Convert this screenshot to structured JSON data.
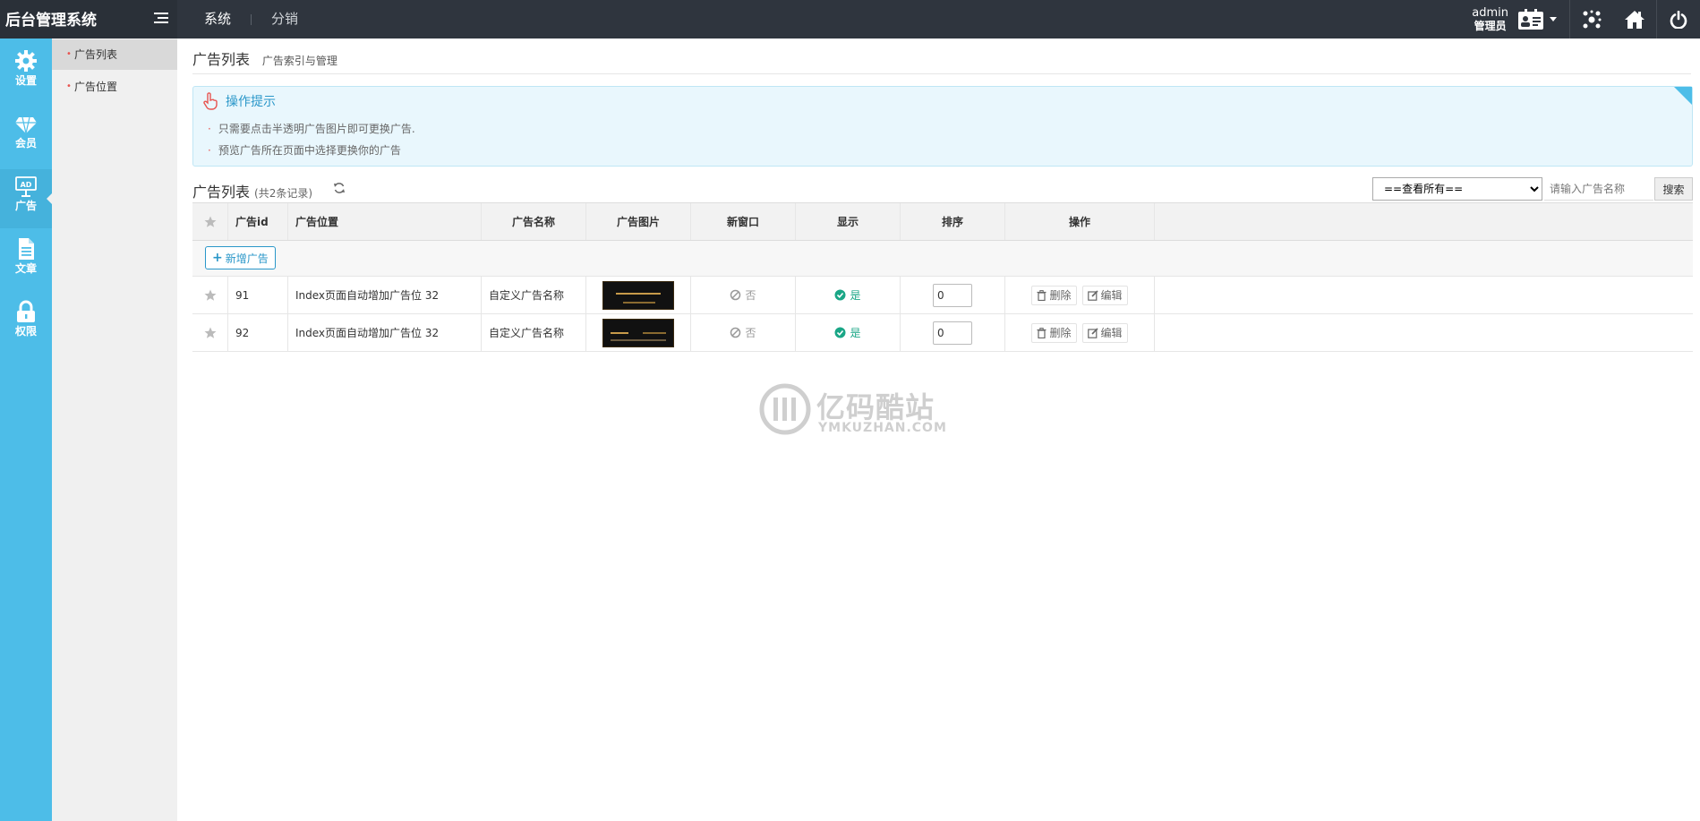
{
  "app": {
    "title": "后台管理系统"
  },
  "top_nav": [
    {
      "label": "系统"
    },
    {
      "label": "分销"
    }
  ],
  "user": {
    "name": "admin",
    "role": "管理员"
  },
  "sidebar": {
    "items": [
      {
        "label": "设置",
        "icon": "gear-icon"
      },
      {
        "label": "会员",
        "icon": "diamond-icon"
      },
      {
        "label": "广告",
        "icon": "ad-icon"
      },
      {
        "label": "文章",
        "icon": "document-icon"
      },
      {
        "label": "权限",
        "icon": "lock-icon"
      }
    ],
    "active": "广告"
  },
  "submenu": {
    "items": [
      {
        "label": "广告列表"
      },
      {
        "label": "广告位置"
      }
    ],
    "active": "广告列表"
  },
  "page": {
    "title": "广告列表",
    "subtitle": "广告索引与管理"
  },
  "tips": {
    "title": "操作提示",
    "lines": [
      "只需要点击半透明广告图片即可更换广告.",
      "预览广告所在页面中选择更换你的广告"
    ]
  },
  "list": {
    "title": "广告列表",
    "count": "(共2条记录)",
    "filter_selected": "==查看所有==",
    "search_placeholder": "请输入广告名称",
    "search_label": "搜索",
    "add_label": "新增广告"
  },
  "table": {
    "columns": [
      "广告id",
      "广告位置",
      "广告名称",
      "广告图片",
      "新窗口",
      "显示",
      "排序",
      "操作"
    ],
    "rows": [
      {
        "id": "91",
        "position": "Index页面自动增加广告位 32",
        "name": "自定义广告名称",
        "new_window": "否",
        "display": "是",
        "sort": "0",
        "delete_label": "删除",
        "edit_label": "编辑"
      },
      {
        "id": "92",
        "position": "Index页面自动增加广告位 32",
        "name": "自定义广告名称",
        "new_window": "否",
        "display": "是",
        "sort": "0",
        "delete_label": "删除",
        "edit_label": "编辑"
      }
    ]
  },
  "watermark": {
    "text": "亿码酷站",
    "sub": "YMKUZHAN.COM"
  },
  "colors": {
    "topbar": "#2f353e",
    "sidebar": "#4dbde8",
    "accent": "#2a97c9",
    "success": "#1aa686"
  }
}
